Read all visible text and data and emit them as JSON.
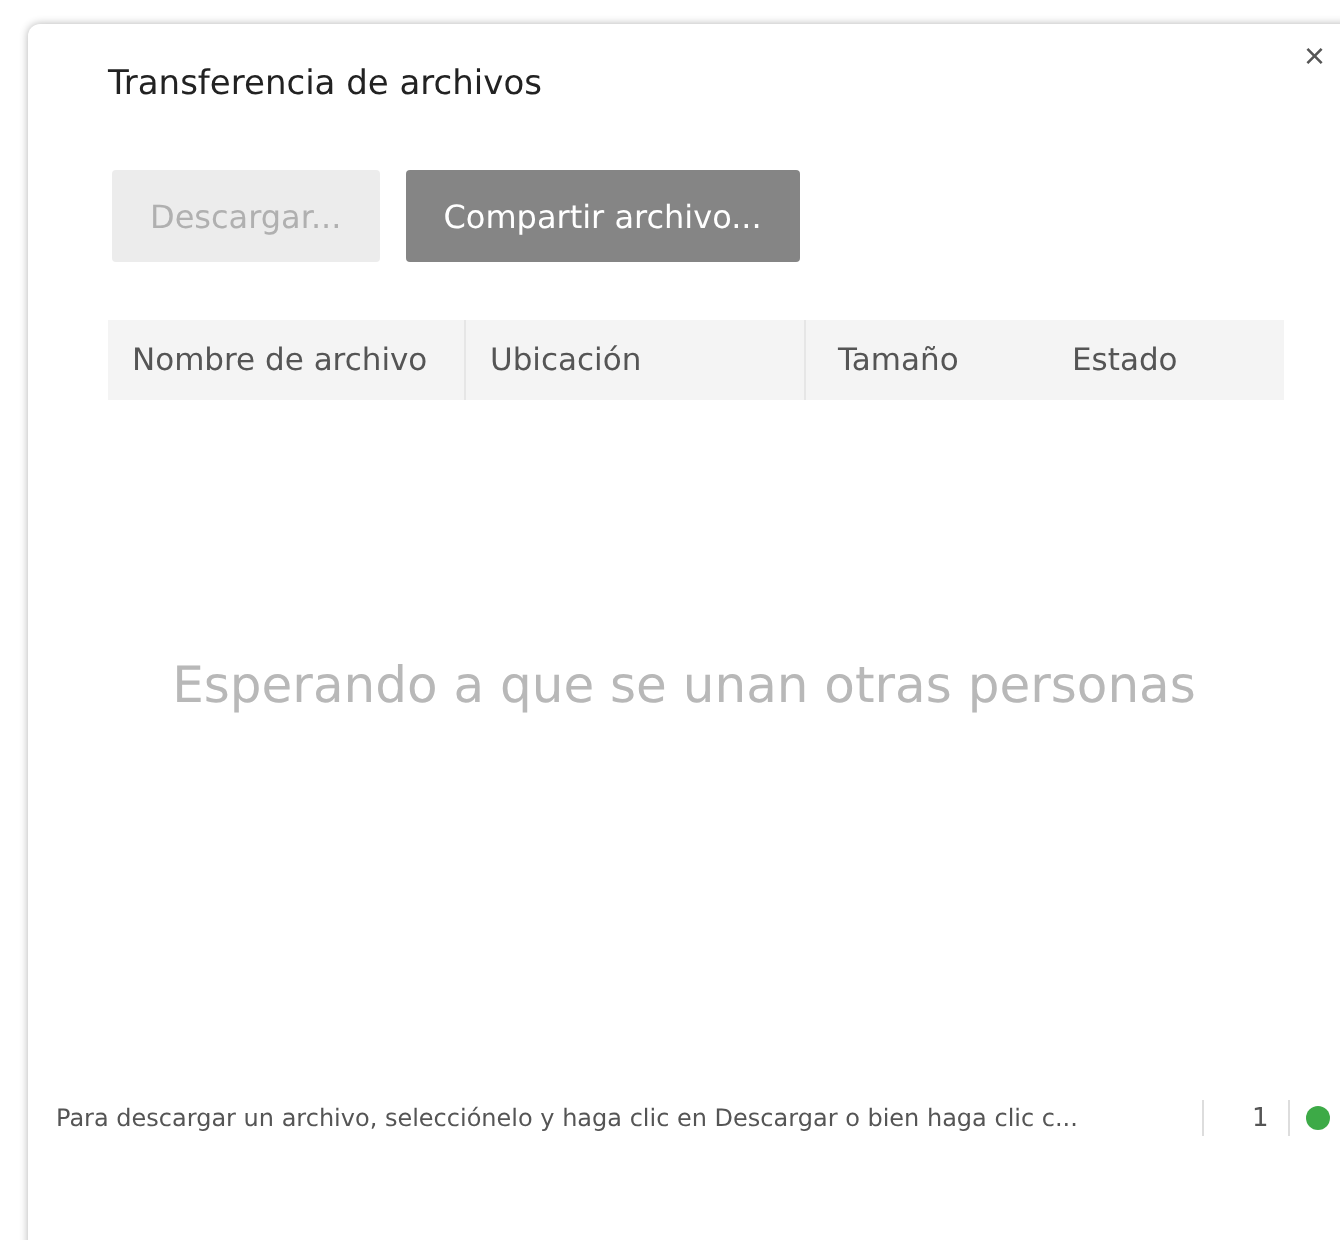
{
  "window": {
    "title": "Transferencia de archivos",
    "close": "×"
  },
  "buttons": [
    {
      "label": "Descargar...",
      "disabled": true
    },
    {
      "label": "Compartir archivo...",
      "disabled": false
    }
  ],
  "table": {
    "columns": [
      "Nombre de archivo",
      "Ubicación",
      "Tamaño",
      "Estado"
    ],
    "empty_message": "Esperando a que se unan otras personas"
  },
  "status_bar": {
    "text": "Para descargar un archivo, selecciónelo y haga clic en Descargar o bien haga clic c...",
    "count": "1"
  }
}
